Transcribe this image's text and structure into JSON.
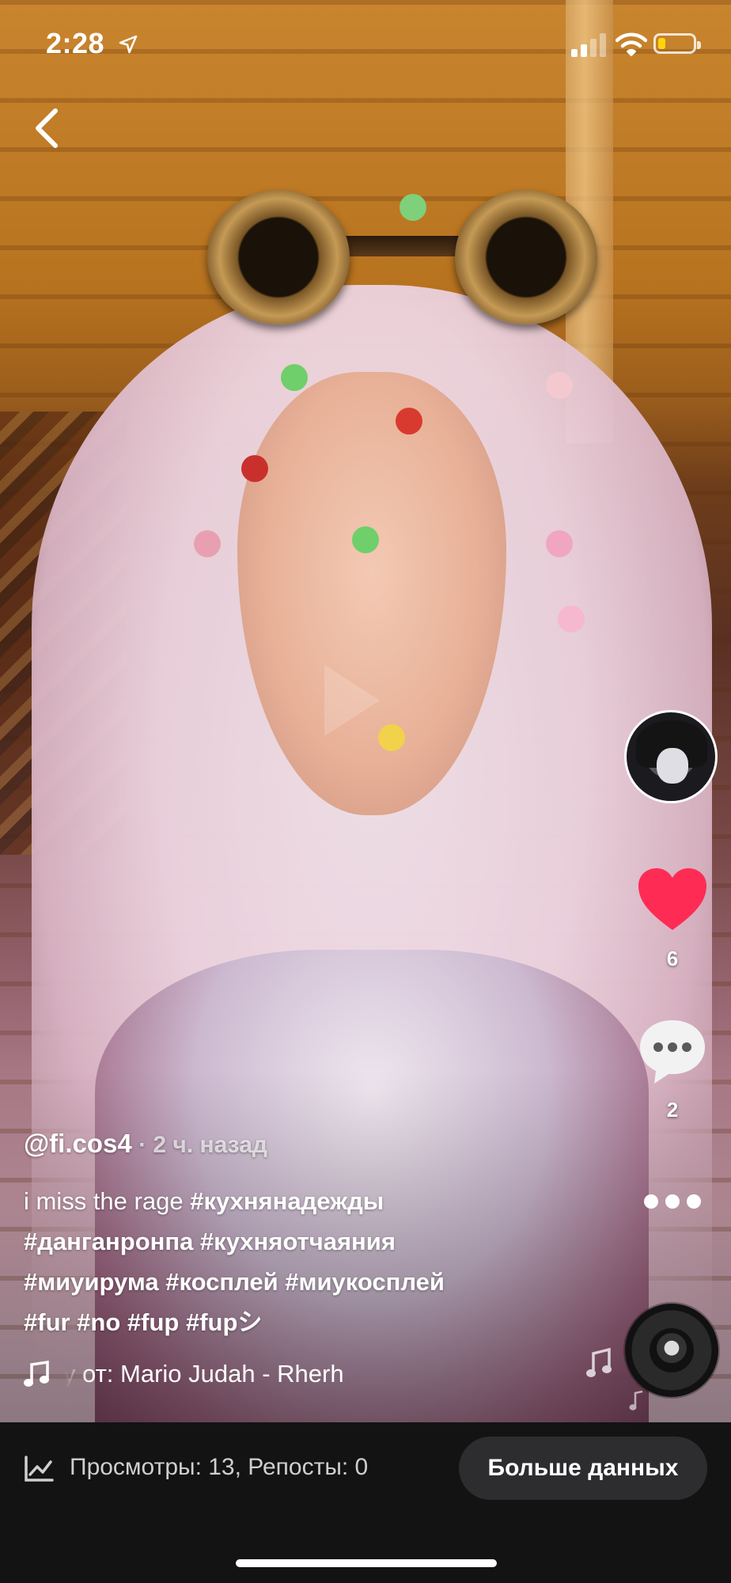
{
  "status_bar": {
    "time": "2:28",
    "battery_color": "#ffd60a",
    "battery_level": 0.22
  },
  "post": {
    "username": "@fi.cos4",
    "posted_ago": " · 2 ч. назад",
    "caption_lines": [
      [
        "i miss the rage ",
        "#кухнянадежды"
      ],
      [
        "#данганронпа #кухняотчаяния"
      ],
      [
        "#миуирума #косплей #миукосплей"
      ],
      [
        "#fur #no #fup #fupシ"
      ]
    ],
    "music_text": "ку от: Mario Judah - Rherh"
  },
  "actions": {
    "like_count": "6",
    "comment_count": "2",
    "like_color": "#fe2c55"
  },
  "stats_bar": {
    "stats_text": "Просмотры: 13, Репосты: 0",
    "more_data_label": "Больше данных"
  },
  "icons": {
    "back": "chevron-left-icon",
    "location": "location-arrow-icon",
    "signal": "cellular-signal-icon",
    "wifi": "wifi-icon",
    "battery": "battery-icon",
    "heart": "heart-icon",
    "comment": "comment-bubble-icon",
    "more": "more-dots-icon",
    "music": "music-note-icon",
    "analytics": "analytics-chart-icon"
  }
}
